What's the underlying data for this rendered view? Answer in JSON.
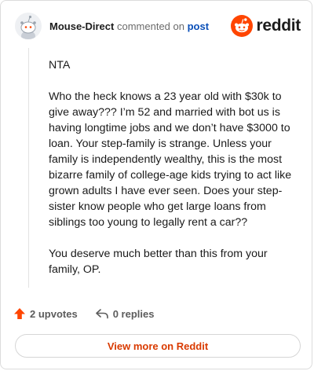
{
  "header": {
    "author": "Mouse-Direct",
    "action_text": "commented on",
    "target": "post",
    "logo_text": "reddit"
  },
  "comment": {
    "paragraphs": [
      "NTA",
      "Who the heck knows a 23 year old with $30k to give away??? I’m 52 and married with bot us is having longtime jobs and we don’t have $3000 to loan. Your step-family is strange. Unless your family is independently wealthy, this is the most bizarre family of college-age kids trying to act like grown adults I have ever seen. Does your step-sister know people who get large loans from siblings too young to legally rent a car??",
      "You deserve much better than this from your family, OP."
    ]
  },
  "actions": {
    "upvotes": "2 upvotes",
    "replies": "0 replies",
    "upvote_icon": "upvote-arrow-icon",
    "reply_icon": "reply-arrow-icon"
  },
  "footer": {
    "view_more": "View more on Reddit"
  },
  "colors": {
    "brand": "#ff4500",
    "link": "#0a4fb8",
    "cta": "#d93a00"
  }
}
